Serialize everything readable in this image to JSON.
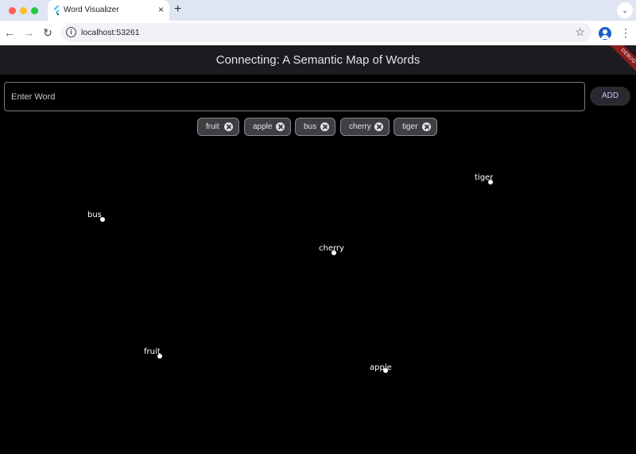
{
  "browser": {
    "tab_title": "Word Visualizer",
    "tab_close": "×",
    "new_tab": "+",
    "url": "localhost:53261"
  },
  "app": {
    "title": "Connecting: A Semantic Map of Words",
    "debug_banner": "DEBUG",
    "input_placeholder": "Enter Word",
    "add_label": "ADD"
  },
  "chips": [
    "fruit",
    "apple",
    "bus",
    "cherry",
    "tiger"
  ],
  "map_words": [
    {
      "word": "tiger"
    },
    {
      "word": "bus"
    },
    {
      "word": "cherry"
    },
    {
      "word": "fruit"
    },
    {
      "word": "apple"
    }
  ]
}
